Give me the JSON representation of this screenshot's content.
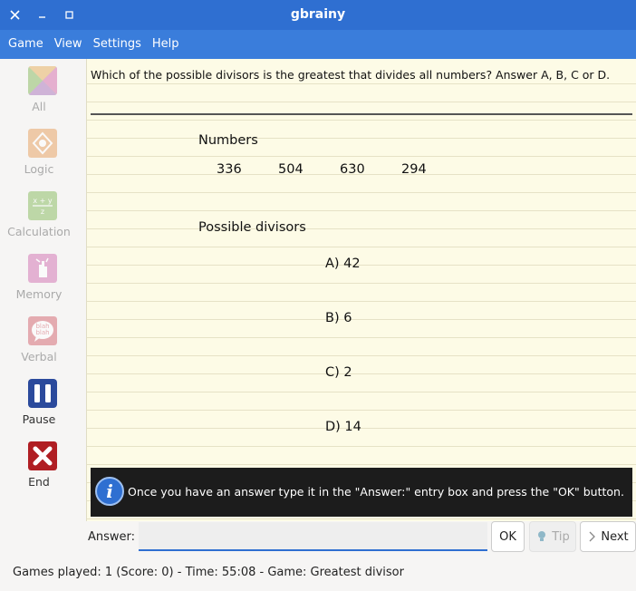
{
  "window": {
    "title": "gbrainy"
  },
  "menu": {
    "items": [
      "Game",
      "View",
      "Settings",
      "Help"
    ]
  },
  "sidebar": {
    "items": [
      {
        "label": "All",
        "icon": "all-games-icon"
      },
      {
        "label": "Logic",
        "icon": "logic-icon"
      },
      {
        "label": "Calculation",
        "icon": "calculation-icon"
      },
      {
        "label": "Memory",
        "icon": "memory-icon"
      },
      {
        "label": "Verbal",
        "icon": "verbal-icon"
      },
      {
        "label": "Pause",
        "icon": "pause-icon"
      },
      {
        "label": "End",
        "icon": "end-icon"
      }
    ]
  },
  "puzzle": {
    "question": "Which of the possible divisors is the greatest that divides all numbers? Answer A, B, C or D.",
    "numbers_heading": "Numbers",
    "numbers": [
      "336",
      "504",
      "630",
      "294"
    ],
    "divisors_heading": "Possible divisors",
    "options": [
      "A) 42",
      "B) 6",
      "C) 2",
      "D) 14"
    ]
  },
  "tip": {
    "message": "Once you have an answer type it in the \"Answer:\" entry box and press the \"OK\" button."
  },
  "answer": {
    "label": "Answer:",
    "value": ""
  },
  "buttons": {
    "ok": "OK",
    "tip": "Tip",
    "next": "Next"
  },
  "status": {
    "text": "Games played: 1 (Score: 0) - Time: 55:08 - Game: Greatest divisor"
  },
  "colors": {
    "accent": "#2f6fd1",
    "paper": "#fdfbe6",
    "end": "#b01e23",
    "pause": "#2b4a9c"
  }
}
